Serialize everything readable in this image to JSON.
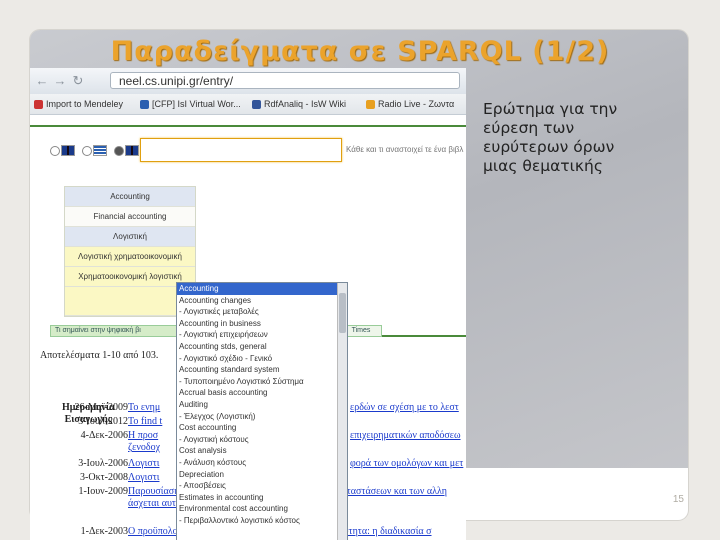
{
  "slide": {
    "title": "Παραδείγματα σε SPARQL (1/2)",
    "description": "Ερώτημα για την εύρεση των ευρύτερων όρων μιας θεματικής",
    "page_number": "15"
  },
  "browser": {
    "back_icon": "back-arrow-icon",
    "forward_icon": "forward-arrow-icon",
    "reload_icon": "reload-icon",
    "url": "neel.cs.unipi.gr/entry/",
    "bookmarks": [
      {
        "label": "Import to Mendeley"
      },
      {
        "label": "[CFP] IsI Virtual Wor..."
      },
      {
        "label": "RdfAnaliq - IsW Wiki"
      },
      {
        "label": "Radio Live - Ζωντα"
      }
    ]
  },
  "search": {
    "languages": [
      "uk-flag-icon",
      "greek-flag-icon",
      "uk-flag-icon"
    ],
    "hint": "Κάθε και τι αναστοιχεί τε ένα βιβλ"
  },
  "terms_panel": {
    "items": [
      {
        "label": "Accounting",
        "style": "blue"
      },
      {
        "label": "Financial accounting",
        "style": "white"
      },
      {
        "label": "Λογιστική",
        "style": "blue"
      },
      {
        "label": "Λογιστική χρηματοοικονομική",
        "style": "yellow"
      },
      {
        "label": "Χρηματοοικονομική λογιστική",
        "style": "yellow"
      }
    ]
  },
  "dropdown": {
    "items": [
      "Accounting",
      "Accounting changes",
      "- Λογιστικές μεταβολές",
      "Accounting in business",
      "- Λογιστική επιχειρήσεων",
      "Accounting stds, general",
      "- Λογιστικό σχέδιο - Γενικό",
      "Accounting standard system",
      "- Τυποποιημένο Λογιστικό Σύστημα",
      "Accrual basis accounting",
      "Auditing",
      "- Έλεγχος (Λογιστική)",
      "Cost accounting",
      "- Λογιστική κόστους",
      "Cost analysis",
      "- Ανάλυση κόστους",
      "Depreciation",
      "- Αποσβέσεις",
      "Estimates in accounting",
      "Environmental cost accounting",
      "- Περιβαλλοντικό λογιστικό κόστος"
    ]
  },
  "tabs": {
    "left": "Τι σημαίνει στην ψηφιακή βι",
    "right": "Times"
  },
  "results": {
    "count_text": "Αποτελέσματα 1-10 από 103.",
    "date_header_1": "Ημερομηνία",
    "date_header_2": "Εισαγωγής",
    "rows": [
      {
        "date": "26-Μαϊ-2009",
        "left": "Το ενημ",
        "right": "ερδών σε σχέση με το λεστ"
      },
      {
        "date": "3-Ιουλ-2012",
        "left": "To find t",
        "right": ""
      },
      {
        "date": "4-Δεκ-2006",
        "left": "Η προσ",
        "right": "επιχειρηματικών αποδόσεω"
      },
      {
        "date": "",
        "left": "ζενοδοχ",
        "right": ""
      },
      {
        "date": "3-Ιουλ-2006",
        "left": "Λογιστι",
        "right": "φορά των ομολόγων και μετ"
      },
      {
        "date": "3-Οκτ-2008",
        "left": "Λογιστι",
        "right": ""
      },
      {
        "date": "1-Ιουν-2009",
        "left": "Παρουσίαση και σχεδιασμός των ενδομηχανικών εγκαταστάσεων και των αλλη",
        "right": ""
      },
      {
        "date": "",
        "left": "άσχεται αυτών",
        "right": ""
      },
      {
        "date": "1-Δεκ-2003",
        "left": "Ο προϋπολογισμός του κόστους με βάση τη δραστηριότητα: η διαδικασία σ",
        "right": ""
      }
    ]
  }
}
